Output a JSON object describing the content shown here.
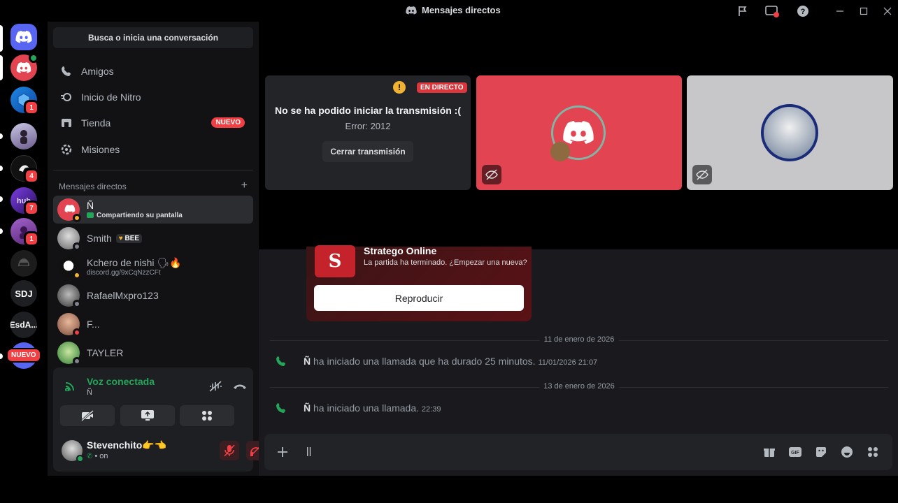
{
  "window": {
    "title": "Mensajes directos"
  },
  "servers": [
    {
      "name": "home",
      "initials": ""
    },
    {
      "name": "server-red-avatar",
      "initials": ""
    },
    {
      "name": "server-cube",
      "initials": "",
      "badge": "1"
    },
    {
      "name": "server-anime",
      "initials": ""
    },
    {
      "name": "server-bw",
      "initials": "",
      "badge": "4"
    },
    {
      "name": "server-neon",
      "initials": "",
      "badge": "7"
    },
    {
      "name": "server-purple",
      "initials": "",
      "badge": "1"
    },
    {
      "name": "server-helmet",
      "initials": ""
    },
    {
      "name": "server-sdj",
      "initials": "SDJ"
    },
    {
      "name": "server-esda",
      "initials": "EsdA..."
    },
    {
      "name": "server-nuevo",
      "initials": "",
      "label": "NUEVO",
      "badge": "1"
    }
  ],
  "sidebar": {
    "search_label": "Busca o inicia una conversación",
    "nav": [
      {
        "label": "Amigos"
      },
      {
        "label": "Inicio de Nitro"
      },
      {
        "label": "Tienda",
        "badge": "NUEVO"
      },
      {
        "label": "Misiones"
      }
    ],
    "dm_header": "Mensajes directos",
    "dm_add": "+",
    "dms": [
      {
        "name": "Ñ",
        "sub": "Compartiendo su pantalla"
      },
      {
        "name": "Smith",
        "tag": "BEE"
      },
      {
        "name": "Kchero de nishi 🗣🔥",
        "sub": "discord.gg/9xCqNzzCFt"
      },
      {
        "name": "RafaelMxpro123"
      },
      {
        "name": "F..."
      },
      {
        "name": "TAYLER"
      }
    ]
  },
  "voice": {
    "status": "Voz conectada",
    "channel": "Ñ"
  },
  "user": {
    "name": "Stevenchito👉👈",
    "status": "• on"
  },
  "stream": {
    "live_label": "EN DIRECTO",
    "warning": "!",
    "error_title": "No se ha podido iniciar la transmisión :(",
    "error_code": "Error: 2012",
    "close_button": "Cerrar transmisión"
  },
  "chat": {
    "game": {
      "logo": "S",
      "title": "Stratego Online",
      "subtitle": "La partida ha terminado. ¿Empezar una nueva?",
      "button": "Reproducir"
    },
    "divider1": "11 de enero de 2026",
    "call1": {
      "user": "Ñ",
      "text": "ha iniciado una llamada que ha durado 25 minutos.",
      "time": "11/01/2026 21:07"
    },
    "divider2": "13 de enero de 2026",
    "call2": {
      "user": "Ñ",
      "text": "ha iniciado una llamada.",
      "time": "22:39"
    },
    "input_value": "||"
  },
  "colors": {
    "accent": "#5865f2",
    "danger": "#f23f43",
    "online": "#23a55a",
    "tile_red": "#e34452",
    "tile_gray": "#c7c6c9"
  }
}
